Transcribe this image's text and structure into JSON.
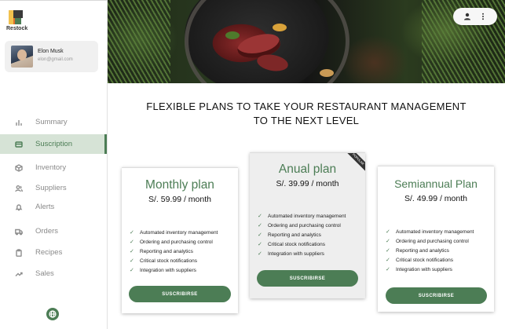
{
  "app": {
    "name": "Restock"
  },
  "user": {
    "name": "Elon Musk",
    "email": "elon@gmail.com"
  },
  "sidebar": {
    "items": [
      {
        "label": "Summary",
        "icon": "bar-chart-icon",
        "active": false
      },
      {
        "label": "Suscription",
        "icon": "card-icon",
        "active": true
      },
      {
        "label": "Inventory",
        "icon": "box-icon",
        "active": false
      },
      {
        "label": "Suppliers",
        "icon": "users-icon",
        "active": false
      },
      {
        "label": "Alerts",
        "icon": "bell-icon",
        "active": false
      },
      {
        "label": "Orders",
        "icon": "truck-icon",
        "active": false
      },
      {
        "label": "Recipes",
        "icon": "clipboard-icon",
        "active": false
      },
      {
        "label": "Sales",
        "icon": "trending-icon",
        "active": false
      }
    ]
  },
  "headline": {
    "line1": "FLEXIBLE PLANS TO TAKE YOUR RESTAURANT MANAGEMENT",
    "line2": "TO THE NEXT LEVEL"
  },
  "plans": [
    {
      "title": "Monthly plan",
      "price": "S/. 59.99 / month",
      "features": [
        "Automated inventory management",
        "Ordering and purchasing control",
        "Reporting and analytics",
        "Critical stock notifications",
        "Integration with suppliers"
      ],
      "button": "SUSCRIBIRSE"
    },
    {
      "title": "Anual plan",
      "price": "S/. 39.99 / month",
      "badge": "POPULAR",
      "features": [
        "Automated inventory management",
        "Ordering and purchasing control",
        "Reporting and analytics",
        "Critical stock notifications",
        "Integration with suppliers"
      ],
      "button": "SUSCRIBIRSE"
    },
    {
      "title": "Semiannual Plan",
      "price": "S/. 49.99 / month",
      "features": [
        "Automated inventory management",
        "Ordering and purchasing control",
        "Reporting and analytics",
        "Critical stock notifications",
        "Integration with suppliers"
      ],
      "button": "SUSCRIBIRSE"
    }
  ],
  "colors": {
    "accent": "#4c7d55",
    "active_bg": "#d6e3d6"
  }
}
